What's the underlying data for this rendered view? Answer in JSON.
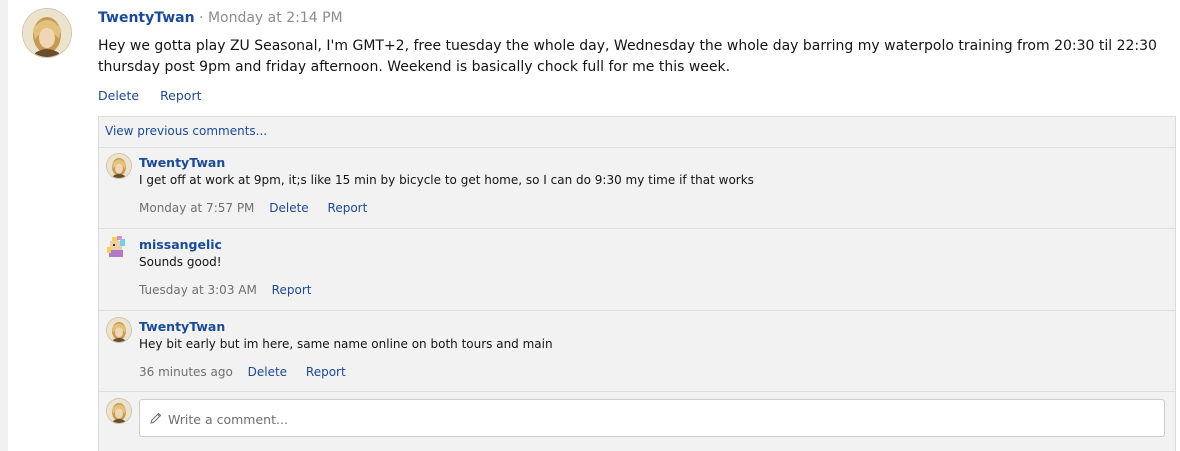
{
  "post": {
    "author": "TwentyTwan",
    "separator": "·",
    "time": "Monday at 2:14 PM",
    "body": "Hey we gotta play ZU Seasonal, I'm GMT+2, free tuesday the whole day, Wednesday the whole day barring my waterpolo training from 20:30 til 22:30 thursday post 9pm and friday afternoon. Weekend is basically chock full for me this week.",
    "actions": {
      "delete": "Delete",
      "report": "Report"
    }
  },
  "comments": {
    "view_previous": "View previous comments...",
    "items": [
      {
        "author": "TwentyTwan",
        "text": "I get off at work at 9pm, it;s like 15 min by bicycle to get home, so I can do 9:30 my time if that works",
        "time": "Monday at 7:57 PM",
        "delete": "Delete",
        "report": "Report"
      },
      {
        "author": "missangelic",
        "text": "Sounds good!",
        "time": "Tuesday at 3:03 AM",
        "report": "Report"
      },
      {
        "author": "TwentyTwan",
        "text": "Hey bit early but im here, same name online on both tours and main",
        "time": "36 minutes ago",
        "delete": "Delete",
        "report": "Report"
      }
    ],
    "write_placeholder": "Write a comment..."
  },
  "icons": {
    "pencil": "pencil-icon",
    "avatar_twentytwan": "avatar",
    "avatar_missangelic": "avatar"
  },
  "colors": {
    "link": "#1a4a9a",
    "muted": "#8c8c8c",
    "panel": "#f2f2f2"
  }
}
